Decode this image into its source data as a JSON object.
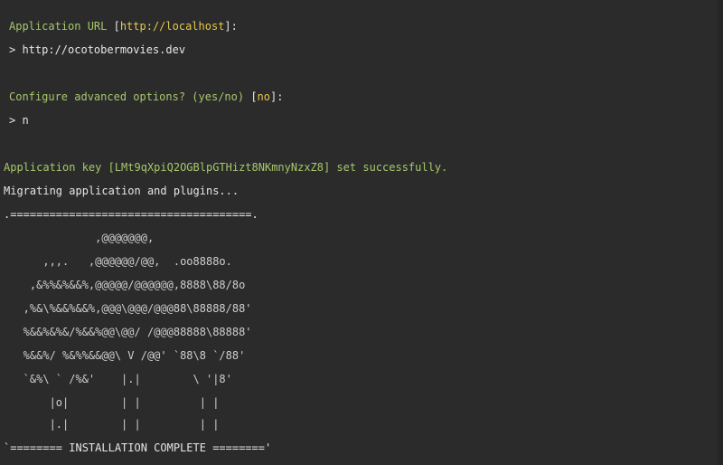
{
  "terminal": {
    "url_prompt": {
      "label": "Application URL ",
      "bracket_open": "[",
      "default": "http://localhost",
      "bracket_close": "]:"
    },
    "url_answer": "> http://ocotobermovies.dev",
    "advanced_prompt": {
      "label": "Configure advanced options? (yes/no) ",
      "bracket_open": "[",
      "default": "no",
      "bracket_close": "]:"
    },
    "advanced_answer": "> n",
    "app_key_line": "Application key [LMt9qXpiQ2OGBlpGTHizt8NKmnyNzxZ8] set successfully.",
    "migrating_line": "Migrating application and plugins...",
    "art_top": ".=====================================.",
    "art_lines": [
      "              ,@@@@@@@,",
      "      ,,,.   ,@@@@@@/@@,  .oo8888o.",
      "    ,&%%&%&&%,@@@@@/@@@@@@,8888\\88/8o",
      "   ,%&\\%&&%&&%,@@@\\@@@/@@@88\\88888/88'",
      "   %&&%&%&/%&&%@@\\@@/ /@@@88888\\88888'",
      "   %&&%/ %&%%&&@@\\ V /@@' `88\\8 `/88'",
      "   `&%\\ ` /%&'    |.|        \\ '|8'",
      "       |o|        | |         | |",
      "       |.|        | |         | |"
    ],
    "art_bottom": "`======== INSTALLATION COMPLETE ========'"
  }
}
